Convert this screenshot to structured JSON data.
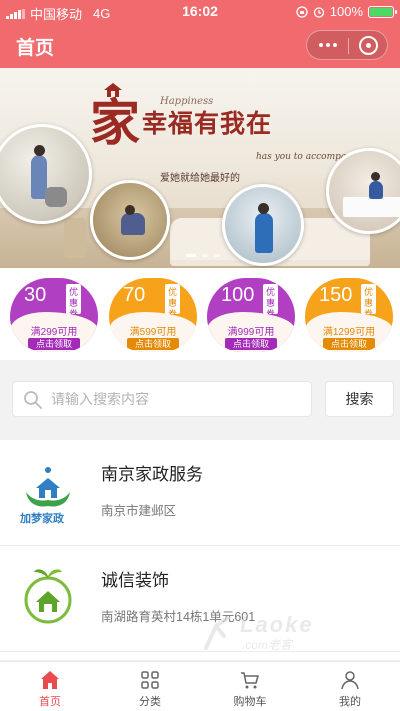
{
  "status_bar": {
    "carrier": "中国移动",
    "network": "4G",
    "time": "16:02",
    "battery_percent": "100%"
  },
  "nav": {
    "title": "首页"
  },
  "banner": {
    "big_char": "家",
    "main_text": "幸福有我在",
    "english_top": "Happiness",
    "english_sub": "has you to accompany",
    "subtitle": "爱她就给她最好的",
    "slide_count": 3,
    "active_slide": 1
  },
  "coupons": [
    {
      "amount": "30",
      "tag": "优惠券",
      "condition": "满299可用",
      "button": "点击领取",
      "color": "purple"
    },
    {
      "amount": "70",
      "tag": "优惠券",
      "condition": "满599可用",
      "button": "点击领取",
      "color": "orange"
    },
    {
      "amount": "100",
      "tag": "优惠券",
      "condition": "满999可用",
      "button": "点击领取",
      "color": "purple"
    },
    {
      "amount": "150",
      "tag": "优惠券",
      "condition": "满1299可用",
      "button": "点击领取",
      "color": "orange"
    }
  ],
  "search": {
    "placeholder": "请输入搜索内容",
    "button": "搜索"
  },
  "stores": [
    {
      "name": "南京家政服务",
      "address": "南京市建邺区",
      "logo_text": "加梦家政",
      "logo_icon": "house-hands-logo"
    },
    {
      "name": "诚信装饰",
      "address": "南湖路育英村14栋1单元601",
      "logo_icon": "green-house-logo"
    }
  ],
  "watermark": {
    "text": "Laoke",
    "sub": ".com老客"
  },
  "tabs": [
    {
      "label": "首页",
      "icon": "home-icon",
      "active": true
    },
    {
      "label": "分类",
      "icon": "category-icon",
      "active": false
    },
    {
      "label": "购物车",
      "icon": "cart-icon",
      "active": false
    },
    {
      "label": "我的",
      "icon": "user-icon",
      "active": false
    }
  ],
  "colors": {
    "primary": "#f06a6e",
    "tab_active": "#e94b4f",
    "coupon_purple": "#b03fc1",
    "coupon_orange": "#f7a21b"
  }
}
